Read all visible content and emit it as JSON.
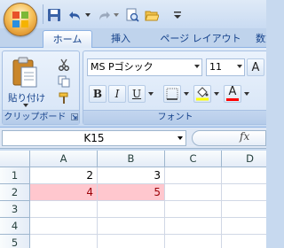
{
  "quick_access": {
    "icons": [
      "save-icon",
      "undo-icon",
      "redo-icon",
      "print-preview-icon",
      "open-icon",
      "customize-qat-icon"
    ]
  },
  "tabs": [
    {
      "label": "ホーム",
      "active": true
    },
    {
      "label": "挿入"
    },
    {
      "label": "ページ レイアウト"
    },
    {
      "label": "数式"
    }
  ],
  "ribbon": {
    "clipboard": {
      "paste_label": "貼り付け",
      "group_label": "クリップボード"
    },
    "font": {
      "font_name": "MS Pゴシック",
      "font_size": "11",
      "group_label": "フォント",
      "bold": "B",
      "italic": "I",
      "underline": "U",
      "font_color_letter": "A"
    }
  },
  "colors": {
    "fill_highlight": "#ffff00",
    "font_color": "#ff0000",
    "conditional_fill": "#ffc7ce",
    "conditional_text": "#9c0006"
  },
  "formula_bar": {
    "name_box": "K15",
    "fx": "fx"
  },
  "grid": {
    "columns": [
      "A",
      "B",
      "C",
      "D"
    ],
    "rows": [
      "1",
      "2",
      "3",
      "4",
      "5"
    ],
    "cells": [
      [
        "2",
        "3",
        "",
        ""
      ],
      [
        "4",
        "5",
        "",
        ""
      ],
      [
        "",
        "",
        "",
        ""
      ],
      [
        "",
        "",
        "",
        ""
      ],
      [
        "",
        "",
        "",
        ""
      ]
    ],
    "highlighted_row": 2
  }
}
